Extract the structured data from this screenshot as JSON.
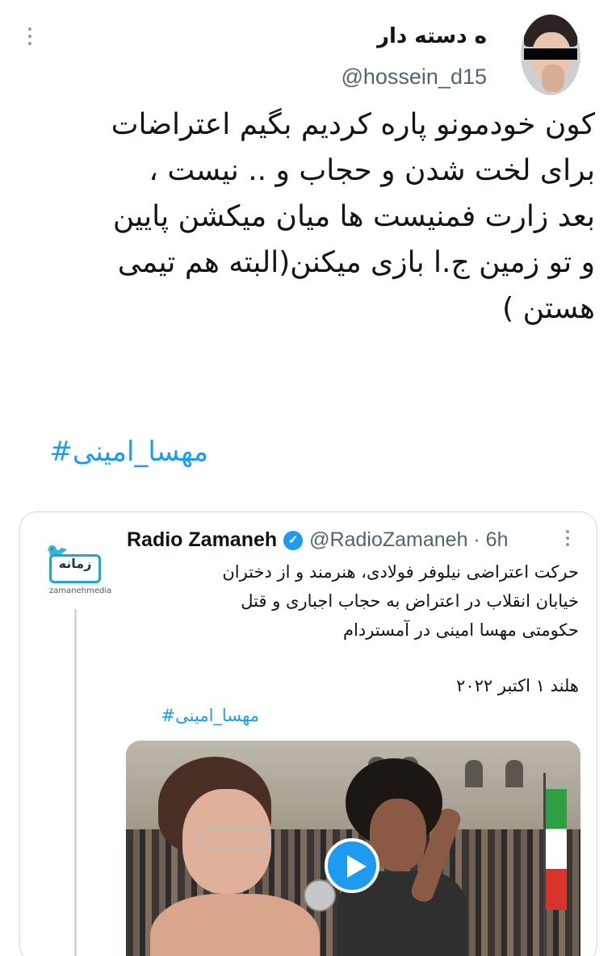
{
  "tweet": {
    "author_name": "ه دسته دار",
    "author_handle": "@hossein_d15",
    "text": "کون خودمونو پاره کردیم بگیم اعتراضات\nبرای لخت شدن و حجاب و .. نیست ،\nبعد زارت فمنیست ها میان میکشن پایین\nو تو زمین ج.ا بازی میکنن(البته هم تیمی\nهستن )",
    "hashtag": "مهسا_امینی#",
    "more_icon": "more-dots-icon",
    "avatar_icon": "avatar"
  },
  "quoted": {
    "name": "Radio Zamaneh",
    "verified_icon": "verified-badge-icon",
    "handle_time": "@RadioZamaneh · 6h",
    "text": "حرکت اعتراضی نیلوفر فولادی، هنرمند و از دختران\nخیابان انقلاب در اعتراض به حجاب اجباری و قتل\nحکومتی مهسا امینی در آمستردام",
    "date": "هلند ۱ اکتبر ۲۰۲۲",
    "hashtag": "مهسا_امینی#",
    "logo_text": "زمانه",
    "logo_subtext": "zamanehmedia",
    "media": {
      "type": "video",
      "play_icon": "play-icon"
    }
  },
  "colors": {
    "link": "#1d9bf0",
    "text": "#0f1419",
    "muted": "#536471",
    "border": "#cfd9de"
  }
}
